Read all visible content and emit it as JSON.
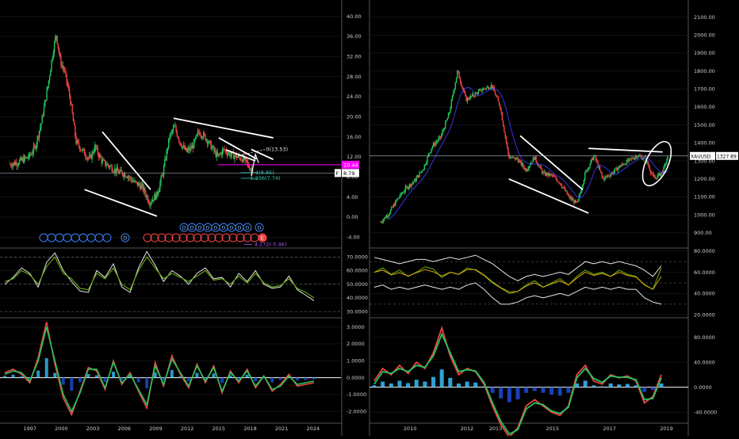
{
  "colors": {
    "background": "#000000",
    "grid": "#1e1e1e",
    "divider": "#555555",
    "axis_text": "#cfcfcf",
    "price_up": "#22c55e",
    "price_down": "#ef4444",
    "trendline": "#ffffff",
    "magenta": "#ff00ff",
    "cyan": "#2dd4bf",
    "blue_marker": "#3b82f6",
    "red_marker": "#ef4444",
    "purple": "#a855f7",
    "ma_blue": "#3b3bff",
    "yellow": "#eab308",
    "osc_green": "#65a30d",
    "osc_blue": "#38bdf8"
  },
  "chart_data": [
    {
      "id": "left-price",
      "type": "candlestick",
      "x_ticks": [
        "1997",
        "2000",
        "2003",
        "2006",
        "2009",
        "2012",
        "2015",
        "2018",
        "2021",
        "2024"
      ],
      "y_ticks": [
        "40.00",
        "36.00",
        "32.00",
        "28.00",
        "24.00",
        "20.00",
        "16.00",
        "12.00",
        "8.00",
        "4.00",
        "0.00",
        "-4.00"
      ],
      "ylim": [
        -6,
        42
      ],
      "series": [
        {
          "x": [
            1995.2,
            1996,
            1997,
            1997.6,
            1998.2,
            1998.8,
            1999.3,
            1999.6,
            2000,
            2000.4,
            2000.9,
            2001.5,
            2002.2,
            2002.8,
            2003.3,
            2004,
            2004.8,
            2005.5,
            2006.3,
            2007,
            2007.8,
            2008.5,
            2009.2,
            2009.8,
            2010.4,
            2010.9,
            2011.4,
            2012,
            2012.6,
            2013.2,
            2013.8,
            2014.4,
            2015,
            2015.6,
            2016.2,
            2016.9,
            2017.5,
            2018,
            2018.4
          ],
          "y": [
            10.5,
            11,
            12,
            14,
            19,
            26,
            33,
            36.5,
            31,
            29,
            24,
            15,
            13,
            11.5,
            14,
            11,
            10,
            9,
            8.5,
            7,
            6,
            3,
            4.5,
            9,
            16,
            18,
            15,
            13,
            14,
            17,
            16,
            14,
            12,
            13.5,
            12.5,
            12,
            11.5,
            10,
            9.5
          ]
        }
      ],
      "annotations": [
        "0(13.53)",
        "1(8.85)",
        "1.236(7.74)",
        "4.272(-5.46)"
      ],
      "price_labels": [
        {
          "text": "10.44",
          "value": 10.44,
          "color": "#ff00ff"
        },
        {
          "text": "8.79",
          "value": 8.79,
          "color": "#ffffff"
        }
      ],
      "flag_letter": "F",
      "event_markers": {
        "blue_D_count": 9,
        "red_count": 16,
        "upper_blue_D_count": 9,
        "letters": [
          "D",
          "E"
        ]
      }
    },
    {
      "id": "left-osc1",
      "type": "line",
      "y_ticks": [
        "70.0000",
        "60.0000",
        "50.0000",
        "40.0000",
        "30.0000"
      ],
      "ylim": [
        26,
        76
      ],
      "series": [
        {
          "name": "",
          "values": [
            50,
            55,
            62,
            58,
            48,
            66,
            73,
            60,
            52,
            45,
            44,
            60,
            55,
            65,
            48,
            44,
            62,
            74,
            64,
            52,
            60,
            56,
            50,
            58,
            62,
            54,
            55,
            48,
            58,
            52,
            60,
            50,
            47,
            48,
            56,
            46,
            42,
            38
          ]
        },
        {
          "name": "",
          "values": [
            52,
            54,
            60,
            57,
            50,
            63,
            70,
            58,
            54,
            47,
            46,
            58,
            54,
            62,
            50,
            46,
            60,
            70,
            62,
            54,
            58,
            55,
            52,
            56,
            60,
            53,
            54,
            50,
            56,
            51,
            58,
            51,
            48,
            49,
            54,
            47,
            44,
            40
          ]
        }
      ]
    },
    {
      "id": "left-osc2",
      "type": "line",
      "y_ticks": [
        "3.0000",
        "2.0000",
        "1.0000",
        "0.0000",
        "-1.0000",
        "-2.0000"
      ],
      "ylim": [
        -2.6,
        3.5
      ],
      "series": [
        {
          "name": "",
          "values": [
            0.3,
            0.5,
            0.2,
            -0.3,
            1.2,
            3.3,
            0.8,
            -1.2,
            -2.2,
            -0.8,
            0.6,
            0.4,
            -0.7,
            1.0,
            -0.4,
            0.3,
            -0.8,
            -1.8,
            0.9,
            -0.5,
            1.3,
            0.2,
            -0.6,
            0.8,
            -0.3,
            0.7,
            -0.9,
            0.4,
            -0.3,
            0.5,
            -0.6,
            0.1,
            -0.8,
            -0.4,
            0.2,
            -0.5,
            -0.4,
            -0.3
          ]
        },
        {
          "name": "",
          "values": [
            0.2,
            0.4,
            0.3,
            -0.2,
            1.0,
            3.0,
            1.0,
            -1.0,
            -2.0,
            -0.9,
            0.5,
            0.5,
            -0.6,
            0.9,
            -0.3,
            0.2,
            -0.7,
            -1.6,
            0.7,
            -0.4,
            1.1,
            0.3,
            -0.5,
            0.7,
            -0.2,
            0.6,
            -0.8,
            0.3,
            -0.2,
            0.4,
            -0.5,
            0.1,
            -0.7,
            -0.5,
            0.1,
            -0.4,
            -0.3,
            -0.2
          ]
        }
      ]
    },
    {
      "id": "right-price",
      "type": "candlestick",
      "x_ticks": [
        "2010",
        "2012",
        "2013",
        "2015",
        "2017",
        "2019"
      ],
      "y_ticks": [
        "2100.00",
        "2000.00",
        "1900.00",
        "1800.00",
        "1700.00",
        "1600.00",
        "1500.00",
        "1400.00",
        "1300.00",
        "1200.00",
        "1100.00",
        "1000.00",
        "900.00"
      ],
      "ylim": [
        820,
        2160
      ],
      "series": [
        {
          "name": "XAUUSD",
          "x": [
            2009.0,
            2009.3,
            2009.6,
            2009.9,
            2010.2,
            2010.5,
            2010.8,
            2011.1,
            2011.4,
            2011.7,
            2012.0,
            2012.3,
            2012.6,
            2012.9,
            2013.2,
            2013.5,
            2013.8,
            2014.1,
            2014.4,
            2014.7,
            2015.0,
            2015.3,
            2015.6,
            2015.9,
            2016.2,
            2016.5,
            2016.8,
            2017.1,
            2017.4,
            2017.7,
            2018.0,
            2018.3,
            2018.6,
            2018.9,
            2019.1
          ],
          "y": [
            960,
            1010,
            1090,
            1150,
            1190,
            1260,
            1380,
            1430,
            1560,
            1800,
            1640,
            1670,
            1700,
            1720,
            1600,
            1320,
            1310,
            1250,
            1320,
            1230,
            1220,
            1180,
            1100,
            1060,
            1240,
            1330,
            1200,
            1230,
            1270,
            1300,
            1330,
            1310,
            1200,
            1240,
            1328
          ]
        }
      ],
      "price_labels": [
        {
          "text": "XAUUSD",
          "value": 1327.89
        },
        {
          "text": "1327.89",
          "value": 1327.89
        }
      ]
    },
    {
      "id": "right-osc1",
      "type": "line",
      "y_ticks": [
        "80.0000",
        "60.0000",
        "40.0000",
        "20.0000"
      ],
      "ylim": [
        18,
        82
      ],
      "series": [
        {
          "name": "",
          "values": [
            60,
            64,
            58,
            62,
            56,
            60,
            65,
            63,
            55,
            60,
            58,
            64,
            62,
            57,
            50,
            45,
            40,
            42,
            48,
            52,
            46,
            50,
            54,
            48,
            56,
            62,
            58,
            60,
            56,
            62,
            58,
            56,
            48,
            44,
            64
          ]
        },
        {
          "name": "",
          "values": [
            74,
            72,
            70,
            68,
            70,
            72,
            72,
            70,
            72,
            74,
            72,
            74,
            76,
            72,
            68,
            62,
            56,
            52,
            56,
            58,
            56,
            58,
            60,
            58,
            64,
            70,
            68,
            70,
            68,
            70,
            68,
            66,
            62,
            56,
            66
          ]
        },
        {
          "name": "",
          "values": [
            46,
            48,
            44,
            46,
            44,
            46,
            48,
            46,
            44,
            46,
            44,
            48,
            50,
            44,
            36,
            30,
            30,
            32,
            36,
            38,
            36,
            38,
            40,
            38,
            42,
            46,
            44,
            46,
            44,
            46,
            44,
            44,
            36,
            32,
            30
          ]
        }
      ]
    },
    {
      "id": "right-osc2",
      "type": "line",
      "y_ticks": [
        "80.0000",
        "40.0000",
        "0.0000",
        "-40.0000"
      ],
      "ylim": [
        -55,
        110
      ],
      "series": [
        {
          "name": "",
          "values": [
            10,
            30,
            20,
            35,
            22,
            40,
            30,
            55,
            95,
            50,
            20,
            30,
            25,
            5,
            -30,
            -60,
            -80,
            -65,
            -30,
            -20,
            -30,
            -40,
            -45,
            -30,
            20,
            35,
            10,
            5,
            20,
            15,
            18,
            10,
            -25,
            -15,
            20
          ]
        },
        {
          "name": "",
          "values": [
            5,
            25,
            22,
            30,
            25,
            35,
            32,
            50,
            85,
            55,
            25,
            28,
            26,
            8,
            -25,
            -55,
            -75,
            -68,
            -35,
            -25,
            -28,
            -38,
            -42,
            -32,
            15,
            30,
            14,
            8,
            18,
            16,
            16,
            12,
            -20,
            -18,
            15
          ]
        }
      ]
    }
  ]
}
